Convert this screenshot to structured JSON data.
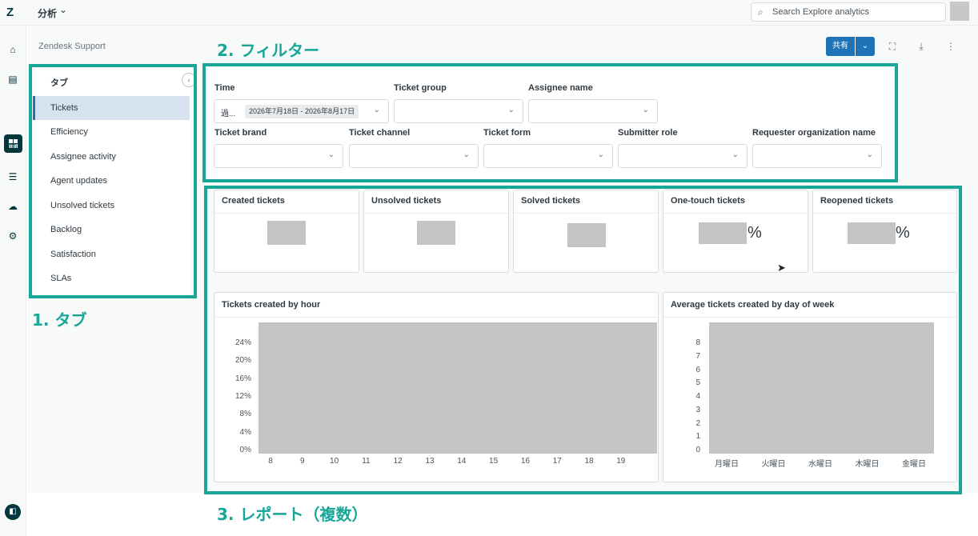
{
  "topbar": {
    "logo": "Z",
    "app_name": "分析",
    "search_placeholder": "Search Explore analytics"
  },
  "breadcrumb": "Zendesk Support",
  "tabs": {
    "title": "タブ",
    "items": [
      {
        "label": "Tickets",
        "active": true
      },
      {
        "label": "Efficiency"
      },
      {
        "label": "Assignee activity"
      },
      {
        "label": "Agent updates"
      },
      {
        "label": "Unsolved tickets"
      },
      {
        "label": "Backlog"
      },
      {
        "label": "Satisfaction"
      },
      {
        "label": "SLAs"
      }
    ]
  },
  "toolbar": {
    "share_label": "共有"
  },
  "annotations": {
    "tabs": "1. タブ",
    "filters": "2. フィルター",
    "reports": "3. レポート（複数）"
  },
  "filters": {
    "time_label": "Time",
    "time_prefix": "過...",
    "time_value": "2026年7月18日 - 2026年8月17日",
    "ticket_group": "Ticket group",
    "assignee_name": "Assignee name",
    "ticket_brand": "Ticket brand",
    "ticket_channel": "Ticket channel",
    "ticket_form": "Ticket form",
    "submitter_role": "Submitter role",
    "requester_org": "Requester organization name"
  },
  "kpis": [
    {
      "title": "Created tickets",
      "suffix": ""
    },
    {
      "title": "Unsolved tickets",
      "suffix": ""
    },
    {
      "title": "Solved tickets",
      "suffix": ""
    },
    {
      "title": "One-touch tickets",
      "suffix": "%"
    },
    {
      "title": "Reopened tickets",
      "suffix": "%"
    }
  ],
  "chart_data": [
    {
      "type": "bar",
      "title": "Tickets created by hour",
      "categories": [
        "8",
        "9",
        "10",
        "11",
        "12",
        "13",
        "14",
        "15",
        "16",
        "17",
        "18",
        "19"
      ],
      "yticks": [
        "24%",
        "20%",
        "16%",
        "12%",
        "8%",
        "4%",
        "0%"
      ],
      "ylim": [
        0,
        24
      ]
    },
    {
      "type": "bar",
      "title": "Average tickets created by day of week",
      "categories": [
        "月曜日",
        "火曜日",
        "水曜日",
        "木曜日",
        "金曜日"
      ],
      "yticks": [
        "8",
        "7",
        "6",
        "5",
        "4",
        "3",
        "2",
        "1",
        "0"
      ],
      "ylim": [
        0,
        8
      ]
    }
  ],
  "colors": {
    "accent": "#1f73b7",
    "annotation": "#17a697",
    "placeholder_block": "#c4c4c4"
  }
}
